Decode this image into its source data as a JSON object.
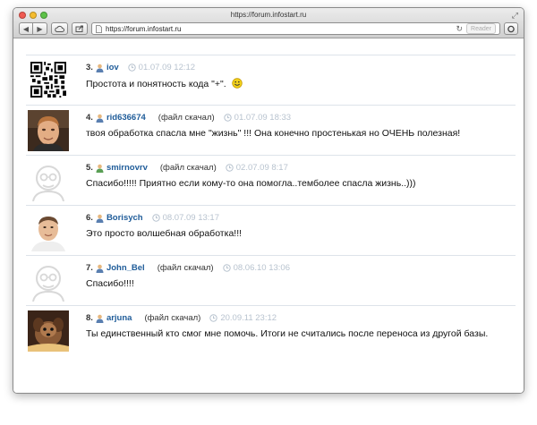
{
  "window": {
    "title": "https://forum.infostart.ru",
    "url": "https://forum.infostart.ru",
    "reader_label": "Reader"
  },
  "posts": [
    {
      "num": "3.",
      "user": "iov",
      "download": "",
      "date": "01.07.09 12:12",
      "text": "Простота и понятность кода \"+\"."
    },
    {
      "num": "4.",
      "user": "rid636674",
      "download": "(файл скачал)",
      "date": "01.07.09 18:33",
      "text": "твоя обработка спасла мне \"жизнь\" !!! Она конечно простенькая но ОЧЕНЬ полезная!"
    },
    {
      "num": "5.",
      "user": "smirnovrv",
      "download": "(файл скачал)",
      "date": "02.07.09 8:17",
      "text": "Спасибо!!!!! Приятно если кому-то она помогла..темболее спасла жизнь..)))"
    },
    {
      "num": "6.",
      "user": "Borisych",
      "download": "",
      "date": "08.07.09 13:17",
      "text": "Это просто волшебная обработка!!!"
    },
    {
      "num": "7.",
      "user": "John_Bel",
      "download": "(файл скачал)",
      "date": "08.06.10 13:06",
      "text": "Спасибо!!!!"
    },
    {
      "num": "8.",
      "user": "arjuna",
      "download": "(файл скачал)",
      "date": "20.09.11 23:12",
      "text": "Ты единственный кто смог мне помочь. Итоги не считались после переноса из другой базы."
    }
  ]
}
